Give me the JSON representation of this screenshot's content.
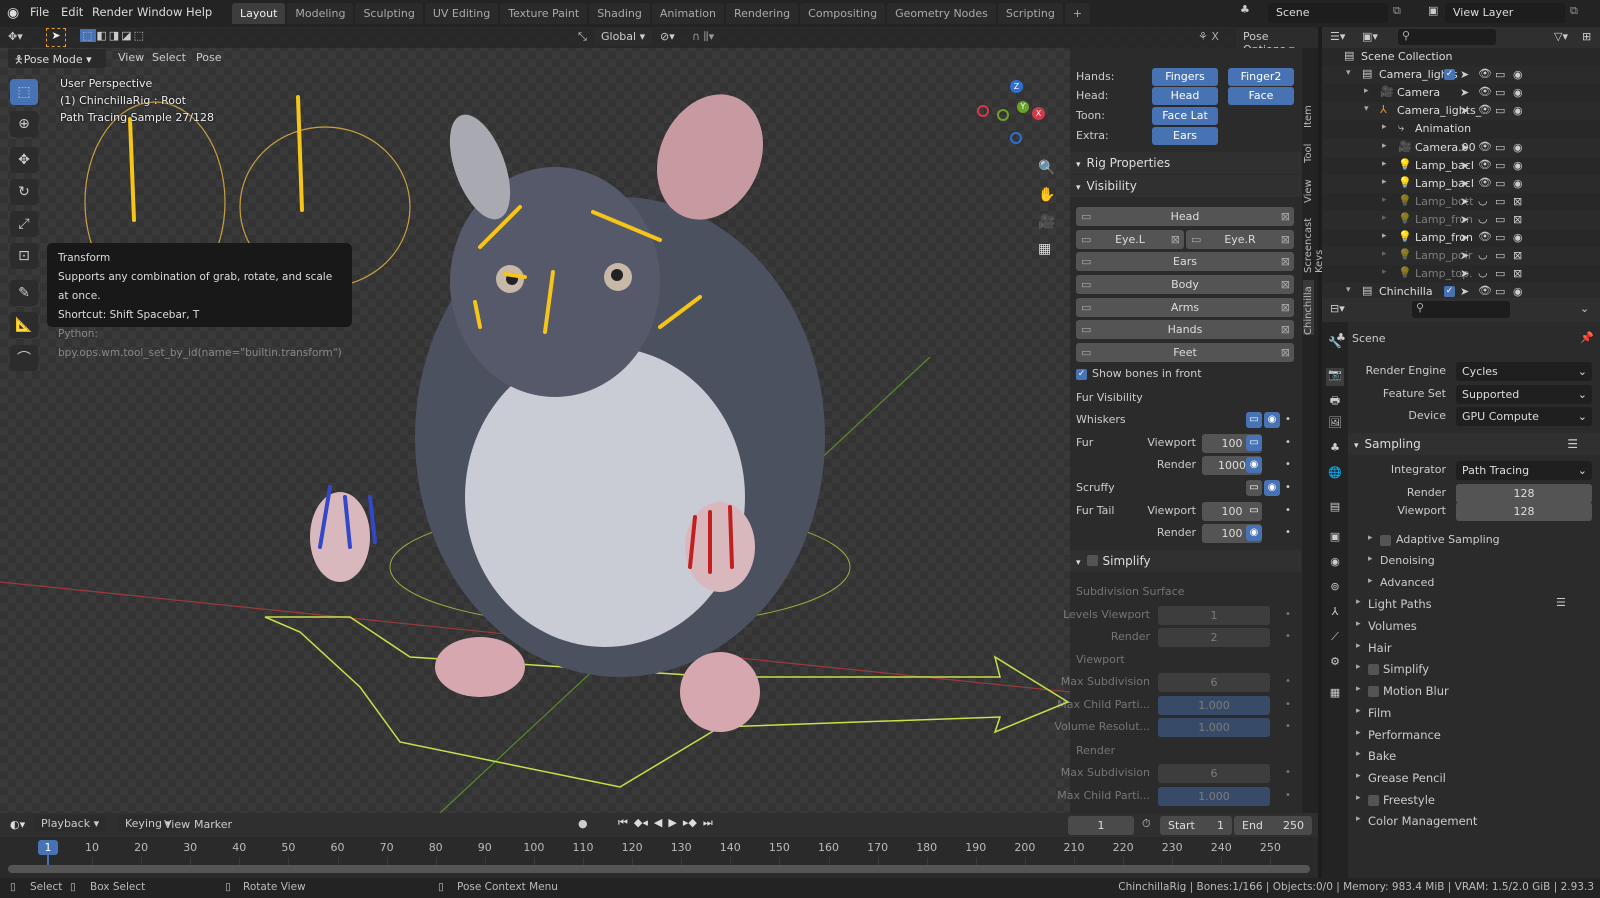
{
  "topbar": {
    "menus": [
      "File",
      "Edit",
      "Render",
      "Window",
      "Help"
    ],
    "workspaces": [
      "Layout",
      "Modeling",
      "Sculpting",
      "UV Editing",
      "Texture Paint",
      "Shading",
      "Animation",
      "Rendering",
      "Compositing",
      "Geometry Nodes",
      "Scripting",
      "+"
    ],
    "active_workspace": "Layout",
    "scene": "Scene",
    "view_layer": "View Layer"
  },
  "viewport": {
    "orientation": "Global",
    "pose_options": "Pose Options",
    "mode": "Pose Mode",
    "menus": [
      "View",
      "Select",
      "Pose"
    ],
    "overlay": [
      "User Perspective",
      "(1) ChinchillaRig : Root",
      "Path Tracing Sample 27/128"
    ],
    "tooltip": {
      "title": "Transform",
      "desc": "Supports any combination of grab, rotate, and scale at once.",
      "shortcut": "Shortcut: Shift Spacebar, T",
      "python": "Python: bpy.ops.wm.tool_set_by_id(name=\"builtin.transform\")"
    },
    "gizmo": {
      "x": "X",
      "y": "Y",
      "z": "Z"
    }
  },
  "npanel": {
    "tabs": [
      "Item",
      "Tool",
      "View",
      "Screencast Keys",
      "Chinchilla"
    ],
    "groups": [
      {
        "label": "Hands:",
        "buttons": [
          "Fingers",
          "Finger2"
        ]
      },
      {
        "label": "Head:",
        "buttons": [
          "Head",
          "Face"
        ]
      },
      {
        "label": "Toon:",
        "buttons": [
          "Face Lat"
        ]
      },
      {
        "label": "Extra:",
        "buttons": [
          "Ears"
        ]
      }
    ],
    "rig_properties": "Rig Properties",
    "visibility": "Visibility",
    "vis_rows": [
      "Head",
      "Eye.L|Eye.R",
      "Ears",
      "Body",
      "Arms",
      "Hands",
      "Feet"
    ],
    "show_bones": "Show bones in front",
    "fur_visibility": "Fur Visibility",
    "whiskers": "Whiskers",
    "fur": "Fur",
    "scruffy": "Scruffy",
    "fur_tail": "Fur Tail",
    "viewport_lbl": "Viewport",
    "render_lbl": "Render",
    "fur_viewport": "100",
    "fur_render": "1000",
    "tail_viewport": "100",
    "tail_render": "100",
    "simplify": "Simplify",
    "subdiv_surface": "Subdivision Surface",
    "levels_viewport": "Levels Viewport",
    "levels_viewport_val": "1",
    "levels_render_val": "2",
    "viewport_section": "Viewport",
    "max_subdivision": "Max Subdivision",
    "max_child": "Max Child Parti...",
    "volume_res": "Volume Resolut...",
    "vp_max_sub": "6",
    "vp_max_child": "1.000",
    "vp_volume": "1.000",
    "render_section": "Render",
    "r_max_sub": "6",
    "r_max_child": "1.000"
  },
  "outliner": {
    "rows": [
      {
        "name": "Scene Collection",
        "depth": 0,
        "kind": "collection",
        "arrow": ""
      },
      {
        "name": "Camera_lights",
        "depth": 1,
        "kind": "collection",
        "arrow": "▾",
        "check": true
      },
      {
        "name": "Camera",
        "depth": 2,
        "kind": "camera",
        "arrow": "▸"
      },
      {
        "name": "Camera_lights_",
        "depth": 2,
        "kind": "empty",
        "arrow": "▾"
      },
      {
        "name": "Animation",
        "depth": 3,
        "kind": "anim",
        "arrow": "▸"
      },
      {
        "name": "Camera.00",
        "depth": 3,
        "kind": "camera",
        "arrow": "▸"
      },
      {
        "name": "Lamp_bacl",
        "depth": 3,
        "kind": "lamp",
        "arrow": "▸"
      },
      {
        "name": "Lamp_bacl",
        "depth": 3,
        "kind": "lamp",
        "arrow": "▸"
      },
      {
        "name": "Lamp_bott",
        "depth": 3,
        "kind": "lamp",
        "arrow": "▸",
        "hidden": true
      },
      {
        "name": "Lamp_fron",
        "depth": 3,
        "kind": "lamp",
        "arrow": "▸",
        "hidden": true
      },
      {
        "name": "Lamp_fron",
        "depth": 3,
        "kind": "lamp",
        "arrow": "▸"
      },
      {
        "name": "Lamp_poir",
        "depth": 3,
        "kind": "lamp",
        "arrow": "▸",
        "hidden": true
      },
      {
        "name": "Lamp_top.",
        "depth": 3,
        "kind": "lamp",
        "arrow": "▸",
        "hidden": true
      },
      {
        "name": "Chinchilla",
        "depth": 1,
        "kind": "collection",
        "arrow": "▾",
        "check": true
      }
    ]
  },
  "properties": {
    "context": "Scene",
    "render_engine_lbl": "Render Engine",
    "render_engine": "Cycles",
    "feature_set_lbl": "Feature Set",
    "feature_set": "Supported",
    "device_lbl": "Device",
    "device": "GPU Compute",
    "sampling": "Sampling",
    "integrator_lbl": "Integrator",
    "integrator": "Path Tracing",
    "render_lbl": "Render",
    "render_samples": "128",
    "viewport_lbl": "Viewport",
    "viewport_samples": "128",
    "sub_sections": [
      "Adaptive Sampling",
      "Denoising",
      "Advanced"
    ],
    "sections": [
      "Light Paths",
      "Volumes",
      "Hair",
      "Simplify",
      "Motion Blur",
      "Film",
      "Performance",
      "Bake",
      "Grease Pencil",
      "Freestyle",
      "Color Management"
    ]
  },
  "timeline": {
    "menus": [
      "Playback",
      "Keying",
      "View",
      "Marker"
    ],
    "current_frame": "1",
    "start_lbl": "Start",
    "start": "1",
    "end_lbl": "End",
    "end": "250",
    "ticks": [
      "10",
      "20",
      "30",
      "40",
      "50",
      "60",
      "70",
      "80",
      "90",
      "100",
      "110",
      "120",
      "130",
      "140",
      "150",
      "160",
      "170",
      "180",
      "190",
      "200",
      "210",
      "220",
      "230",
      "240",
      "250"
    ]
  },
  "status": {
    "select": "Select",
    "box_select": "Box Select",
    "rotate_view": "Rotate View",
    "context_menu": "Pose Context Menu",
    "info": "ChinchillaRig | Bones:1/166 | Objects:0/0 | Memory: 983.4 MiB | VRAM: 1.5/2.0 GiB | 2.93.3"
  },
  "colors": {
    "accent": "#4772b3",
    "bone": "#f5c518",
    "lamp": "#e0913f"
  }
}
